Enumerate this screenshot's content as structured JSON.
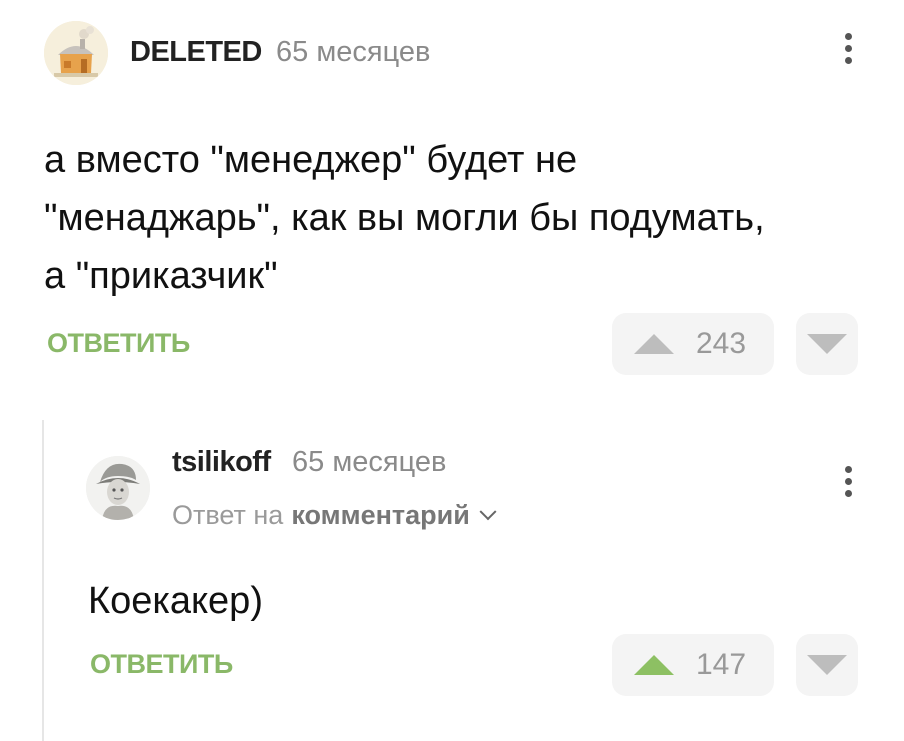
{
  "comment": {
    "author": "DELETED",
    "time": "65 месяцев",
    "text_line1": "а вместо \"менеджер\" будет не",
    "text_line2": "\"менаджарь\", как вы могли бы подумать,",
    "text_line3": "а \"приказчик\"",
    "reply_label": "ОТВЕТИТЬ",
    "votes": "243"
  },
  "reply": {
    "author": "tsilikoff",
    "time": "65 месяцев",
    "reply_to_prefix": "Ответ на",
    "reply_to_target": "комментарий",
    "text": "Коекакер)",
    "reply_label": "ОТВЕТИТЬ",
    "votes": "147",
    "upvoted": true
  },
  "colors": {
    "accent_green": "#8ab868",
    "upvote_active": "#8dc063",
    "vote_bg": "#f4f4f4",
    "muted_text": "#8a8a8a"
  },
  "icons": {
    "more": "more-vertical-icon",
    "upvote": "triangle-up-icon",
    "downvote": "triangle-down-icon",
    "expand": "chevron-down-icon"
  }
}
